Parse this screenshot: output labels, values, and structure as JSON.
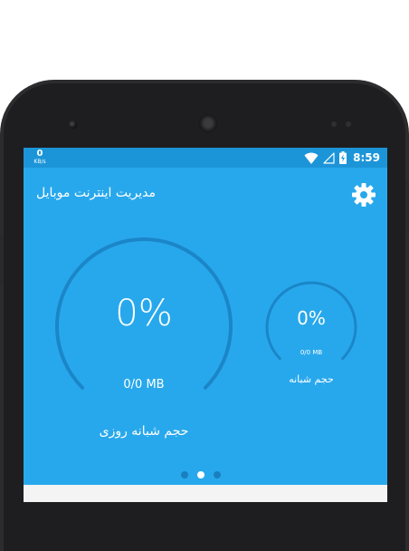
{
  "status_bar": {
    "speed_value": "0",
    "speed_unit": "KB/s",
    "time": "8:59",
    "icons": [
      "wifi-icon",
      "cell-signal-icon",
      "battery-charging-icon"
    ]
  },
  "app_bar": {
    "title": "مدیریت اینترنت موبایل",
    "settings_icon": "gear-icon"
  },
  "daily_gauge": {
    "percent_text": "0%",
    "usage": "0/0 MB",
    "label": "حجم شبانه روزی",
    "fill_fraction": 0
  },
  "night_gauge": {
    "percent_text": "0%",
    "usage": "0/0 MB",
    "label": "حجم شبانه",
    "fill_fraction": 0
  },
  "pager": {
    "page_count": 3,
    "active_index": 1
  },
  "colors": {
    "screen_bg": "#28a8ec",
    "status_bar": "#1c95d8",
    "gauge_track": "#1a86c8",
    "text": "#ffffff",
    "phone_body": "#2c2c2e"
  }
}
